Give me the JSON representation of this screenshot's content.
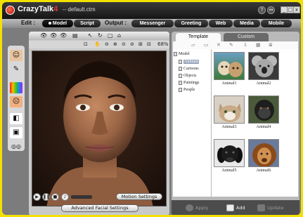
{
  "app": {
    "name": "CrazyTalk",
    "version": "4",
    "document": "-- default.ctm"
  },
  "window_controls": [
    "?",
    "↔",
    "_",
    "□",
    "x"
  ],
  "menubar": {
    "edit_label": "Edit :",
    "edit_items": [
      "Model",
      "Script"
    ],
    "output_label": "Output :",
    "output_items": [
      "Messenger",
      "Greeting",
      "Web",
      "Media",
      "Mobile"
    ]
  },
  "viewer": {
    "zoom": "68%",
    "top_icons": [
      "eye-icon",
      "eye-icon",
      "eye-icon",
      "list-icon",
      "cursor-icon",
      "rotate-icon",
      "box-icon",
      "stamp-icon"
    ],
    "nav_icons": [
      "crop-icon",
      "hand-icon",
      "zoom-out-icon",
      "zoom-in-icon",
      "zoom-minus-icon",
      "zoom-fit-icon",
      "fit-icon",
      "frame-icon"
    ],
    "motion_settings_label": "Motion Settings",
    "advanced_facial_settings_label": "Advanced Facial Settings"
  },
  "library": {
    "tabs": [
      "Template",
      "Custom"
    ],
    "tree_root": "Model",
    "tree_items": [
      "Animals",
      "Cartoons",
      "Objects",
      "Paintings",
      "People"
    ],
    "selected_item": "Animals",
    "thumbnails": [
      "Animal1",
      "Animal2",
      "Animal3",
      "Animal4",
      "Animal5",
      "Animal6"
    ],
    "footer": {
      "apply": "Apply",
      "add": "Add",
      "update": "Update"
    }
  },
  "colors": {
    "accent_yellow": "#f2e000",
    "chrome_dark": "#1a1a1a",
    "panel_gray": "#c9c9c9",
    "selection": "#9aa6bb"
  }
}
